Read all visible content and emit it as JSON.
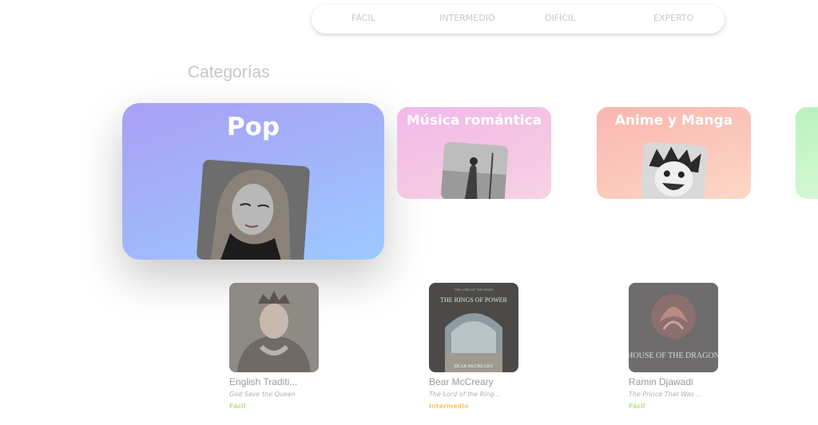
{
  "difficulty_tabs": [
    {
      "label": "FÁCIL"
    },
    {
      "label": "INTERMEDIO"
    },
    {
      "label": "DIFÍCIL"
    },
    {
      "label": "EXPERTO"
    }
  ],
  "categories_title": "Categorías",
  "categories": [
    {
      "title": "Pop",
      "photo_icon": "portrait-photo"
    },
    {
      "title": "Música romántica",
      "photo_icon": "couple-photo"
    },
    {
      "title": "Anime y Manga",
      "photo_icon": "anime-character-photo"
    },
    {
      "title": ""
    }
  ],
  "songs": [
    {
      "artist": "English Traditi...",
      "title": "God Save the Queen",
      "level": "Fácil",
      "level_color": "#b5e38c",
      "art_icon": "queen-portrait"
    },
    {
      "artist": "Bear McCreary",
      "title": "The Lord of the Ring...",
      "level": "Intermedio",
      "level_color": "#f3c96b",
      "art_icon": "rings-of-power-cover",
      "art_text": {
        "top": "THE LORD OF THE RINGS",
        "main": "THE RINGS OF POWER",
        "sub": "BEAR McCREARY"
      }
    },
    {
      "artist": "Ramin Djawadi",
      "title": "The Prince That Was ...",
      "level": "Fácil",
      "level_color": "#b5e38c",
      "art_icon": "house-of-the-dragon-cover",
      "art_text": {
        "main": "HOUSE OF THE DRAGON"
      }
    }
  ]
}
